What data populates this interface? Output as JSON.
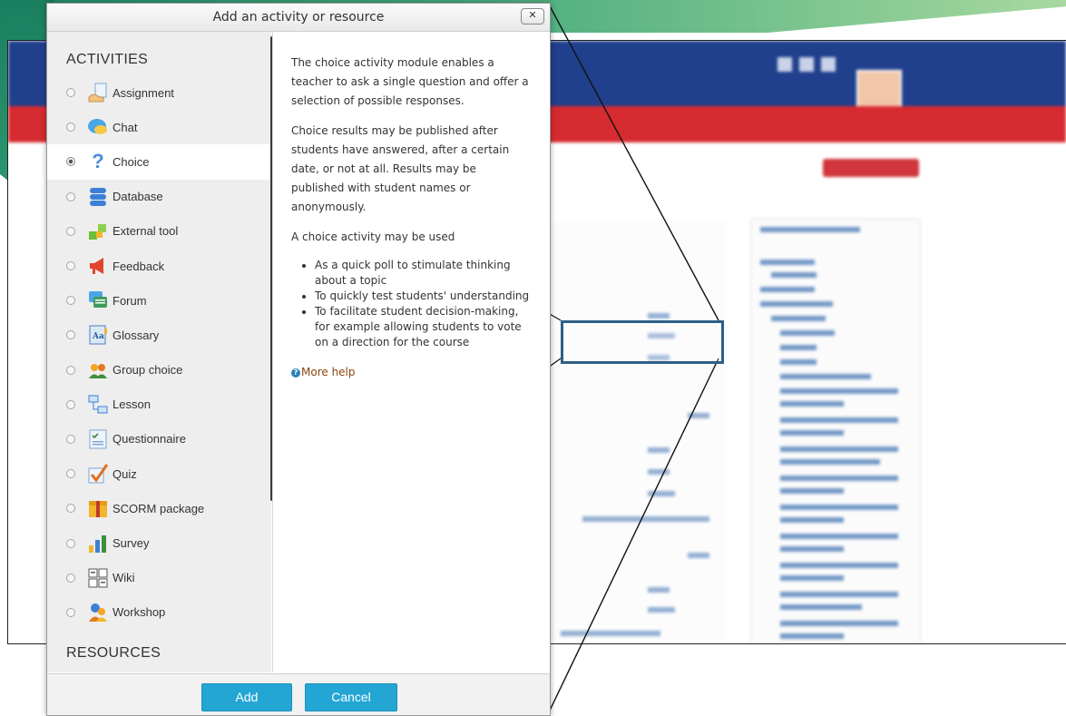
{
  "dialog": {
    "title": "Add an activity or resource",
    "close_glyph": "✕",
    "sections": {
      "activities": "ACTIVITIES",
      "resources": "RESOURCES"
    },
    "modules": [
      {
        "label": "Assignment",
        "icon": "assignment-icon",
        "selected": false
      },
      {
        "label": "Chat",
        "icon": "chat-icon",
        "selected": false
      },
      {
        "label": "Choice",
        "icon": "choice-icon",
        "selected": true
      },
      {
        "label": "Database",
        "icon": "database-icon",
        "selected": false
      },
      {
        "label": "External tool",
        "icon": "external-tool-icon",
        "selected": false
      },
      {
        "label": "Feedback",
        "icon": "feedback-icon",
        "selected": false
      },
      {
        "label": "Forum",
        "icon": "forum-icon",
        "selected": false
      },
      {
        "label": "Glossary",
        "icon": "glossary-icon",
        "selected": false
      },
      {
        "label": "Group choice",
        "icon": "group-choice-icon",
        "selected": false
      },
      {
        "label": "Lesson",
        "icon": "lesson-icon",
        "selected": false
      },
      {
        "label": "Questionnaire",
        "icon": "questionnaire-icon",
        "selected": false
      },
      {
        "label": "Quiz",
        "icon": "quiz-icon",
        "selected": false
      },
      {
        "label": "SCORM package",
        "icon": "scorm-icon",
        "selected": false
      },
      {
        "label": "Survey",
        "icon": "survey-icon",
        "selected": false
      },
      {
        "label": "Wiki",
        "icon": "wiki-icon",
        "selected": false
      },
      {
        "label": "Workshop",
        "icon": "workshop-icon",
        "selected": false
      }
    ],
    "description": {
      "p1": "The choice activity module enables a teacher to ask a single question and offer a selection of possible responses.",
      "p2": "Choice results may be published after students have answered, after a certain date, or not at all. Results may be published with student names or anonymously.",
      "p3": "A choice activity may be used",
      "bullets": [
        "As a quick poll to stimulate thinking about a topic",
        "To quickly test students' understanding",
        "To facilitate student decision-making, for example allowing students to vote on a direction for the course"
      ],
      "help_link": "More help"
    },
    "buttons": {
      "add": "Add",
      "cancel": "Cancel"
    }
  },
  "colors": {
    "button": "#23a6d4",
    "link": "#8a4512",
    "header_blue": "#203f8c",
    "header_red": "#d62b30",
    "callout": "#2e5f87"
  }
}
